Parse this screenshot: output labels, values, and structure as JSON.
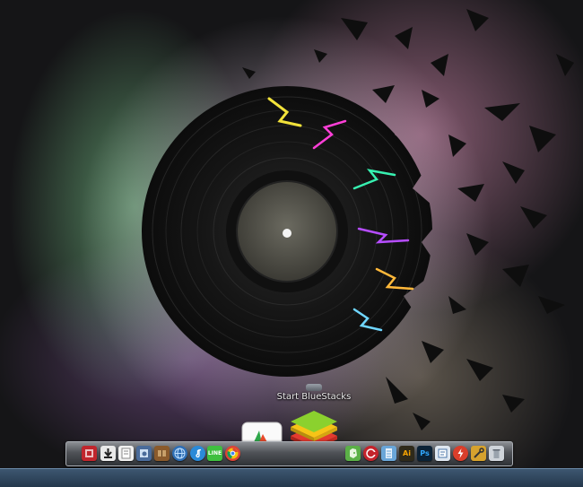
{
  "desktop": {
    "shortcut": {
      "label": "Start BlueStacks",
      "icon": "bluestacks-shortcut-icon"
    }
  },
  "dock": {
    "left_items": [
      {
        "name": "red-app-icon",
        "color": "#c0262d"
      },
      {
        "name": "downloads-icon",
        "color": "#e9e9e9"
      },
      {
        "name": "notes-icon",
        "color": "#f1f1f1"
      },
      {
        "name": "preview-icon",
        "color": "#4a6b9a"
      },
      {
        "name": "books-icon",
        "color": "#8a5a2c"
      },
      {
        "name": "globe-icon",
        "color": "#2f6fb5"
      },
      {
        "name": "itunes-icon",
        "color": "#2b8ad8"
      },
      {
        "name": "line-icon",
        "label": "LINE",
        "color": "#3fbf3f"
      },
      {
        "name": "chrome-icon",
        "color": "#db4437"
      }
    ],
    "featured": [
      {
        "name": "foxit-reader-icon"
      },
      {
        "name": "bluestacks-icon"
      }
    ],
    "right_items": [
      {
        "name": "evernote-icon",
        "color": "#5bb047"
      },
      {
        "name": "ccleaner-icon",
        "color": "#c4242c"
      },
      {
        "name": "notepad-icon",
        "color": "#6aa6d8"
      },
      {
        "name": "illustrator-icon",
        "label": "Ai",
        "color": "#2f2a1a",
        "text_color": "#f7a400"
      },
      {
        "name": "photoshop-icon",
        "label": "Ps",
        "color": "#0b2236",
        "text_color": "#31a8ff"
      },
      {
        "name": "text-editor-icon",
        "color": "#dfe7f0"
      },
      {
        "name": "flash-icon",
        "color": "#d93e2b"
      },
      {
        "name": "tools-icon",
        "color": "#d6a22e"
      },
      {
        "name": "recycle-bin-icon",
        "color": "#cfd4da"
      }
    ]
  }
}
